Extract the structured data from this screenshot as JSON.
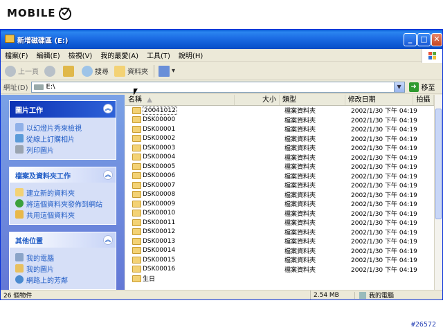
{
  "site": {
    "logo_text": "MOBILE",
    "tag": "#26572"
  },
  "window": {
    "title": "新增磁碟區 (E:)",
    "controls": {
      "minimize": "_",
      "maximize": "□",
      "close": "✕"
    }
  },
  "menu": [
    "檔案(F)",
    "編輯(E)",
    "檢視(V)",
    "我的最愛(A)",
    "工具(T)",
    "說明(H)"
  ],
  "toolbar": {
    "back": "上一頁",
    "search": "搜尋",
    "folders": "資料夾"
  },
  "address": {
    "label": "網址(D)",
    "value": "E:\\",
    "go": "移至"
  },
  "panels": [
    {
      "title": "圖片工作",
      "links": [
        "以幻燈片秀來檢視",
        "從線上訂購相片",
        "列印圖片"
      ]
    },
    {
      "title": "檔案及資料夾工作",
      "links": [
        "建立新的資料夾",
        "將這個資料夾發佈到網站",
        "共用這個資料夾"
      ]
    },
    {
      "title": "其他位置",
      "links": [
        "我的電腦",
        "我的圖片",
        "網路上的芳鄰"
      ]
    }
  ],
  "columns": {
    "name": "名稱",
    "size": "大小",
    "type": "類型",
    "modified": "修改日期",
    "taken": "拍攝"
  },
  "files": [
    {
      "name": "20041012",
      "type": "檔案資料夾",
      "modified": "2002/1/30 下午 04:19"
    },
    {
      "name": "DSK00000",
      "type": "檔案資料夾",
      "modified": "2002/1/30 下午 04:19"
    },
    {
      "name": "DSK00001",
      "type": "檔案資料夾",
      "modified": "2002/1/30 下午 04:19"
    },
    {
      "name": "DSK00002",
      "type": "檔案資料夾",
      "modified": "2002/1/30 下午 04:19"
    },
    {
      "name": "DSK00003",
      "type": "檔案資料夾",
      "modified": "2002/1/30 下午 04:19"
    },
    {
      "name": "DSK00004",
      "type": "檔案資料夾",
      "modified": "2002/1/30 下午 04:19"
    },
    {
      "name": "DSK00005",
      "type": "檔案資料夾",
      "modified": "2002/1/30 下午 04:19"
    },
    {
      "name": "DSK00006",
      "type": "檔案資料夾",
      "modified": "2002/1/30 下午 04:19"
    },
    {
      "name": "DSK00007",
      "type": "檔案資料夾",
      "modified": "2002/1/30 下午 04:19"
    },
    {
      "name": "DSK00008",
      "type": "檔案資料夾",
      "modified": "2002/1/30 下午 04:19"
    },
    {
      "name": "DSK00009",
      "type": "檔案資料夾",
      "modified": "2002/1/30 下午 04:19"
    },
    {
      "name": "DSK00010",
      "type": "檔案資料夾",
      "modified": "2002/1/30 下午 04:19"
    },
    {
      "name": "DSK00011",
      "type": "檔案資料夾",
      "modified": "2002/1/30 下午 04:19"
    },
    {
      "name": "DSK00012",
      "type": "檔案資料夾",
      "modified": "2002/1/30 下午 04:19"
    },
    {
      "name": "DSK00013",
      "type": "檔案資料夾",
      "modified": "2002/1/30 下午 04:19"
    },
    {
      "name": "DSK00014",
      "type": "檔案資料夾",
      "modified": "2002/1/30 下午 04:19"
    },
    {
      "name": "DSK00015",
      "type": "檔案資料夾",
      "modified": "2002/1/30 下午 04:19"
    },
    {
      "name": "DSK00016",
      "type": "檔案資料夾",
      "modified": "2002/1/30 下午 04:19"
    },
    {
      "name": "生日",
      "type": "",
      "modified": ""
    }
  ],
  "status": {
    "count": "26 個物件",
    "size": "2.54 MB",
    "location": "我的電腦"
  },
  "colors": {
    "titlebar": "#0b55d0",
    "taskpane": "#6d8be0",
    "link": "#215dc6",
    "folder": "#f3d275"
  }
}
